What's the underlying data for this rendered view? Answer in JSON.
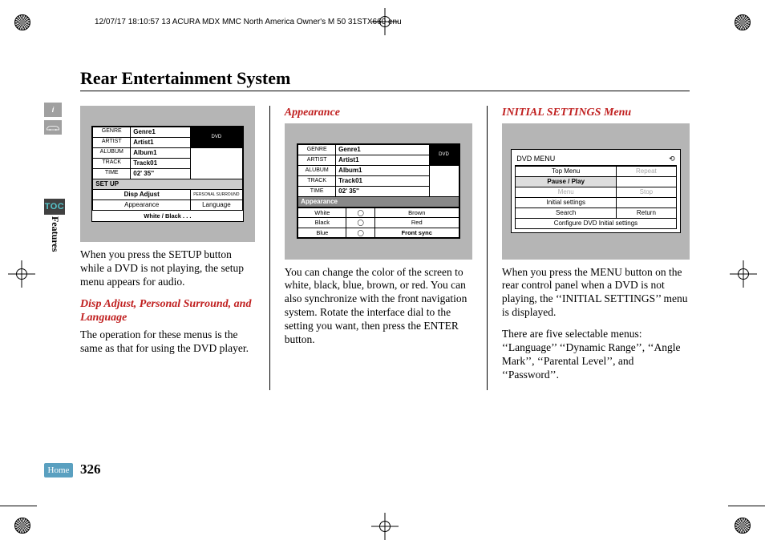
{
  "header": "12/07/17 18:10:57   13 ACURA MDX MMC North America Owner's M 50 31STX660 enu",
  "title": "Rear Entertainment System",
  "sidebar": {
    "toc": "TOC",
    "section": "Features",
    "home": "Home"
  },
  "page_number": "326",
  "col1": {
    "screen": {
      "rows": [
        {
          "label": "GENRE",
          "value": "Genre1"
        },
        {
          "label": "ARTIST",
          "value": "Artist1"
        },
        {
          "label": "ALUBUM",
          "value": "Album1"
        },
        {
          "label": "TRACK",
          "value": "Track01"
        },
        {
          "label": "TIME",
          "value": "02' 35''"
        }
      ],
      "badge": "DVD",
      "setup_label": "SET UP",
      "disp_adjust": "Disp Adjust",
      "personal": "PERSONAL SURROUND",
      "appearance": "Appearance",
      "language": "Language",
      "footer": "White / Black . . ."
    },
    "p1": "When you press the SETUP button while a DVD is not playing, the setup menu appears for audio.",
    "sub": "Disp Adjust, Personal Surround, and Language",
    "p2": "The operation for these menus is the same as that for using the DVD player."
  },
  "col2": {
    "heading": "Appearance",
    "screen": {
      "rows": [
        {
          "label": "GENRE",
          "value": "Genre1"
        },
        {
          "label": "ARTIST",
          "value": "Artist1"
        },
        {
          "label": "ALUBUM",
          "value": "Album1"
        },
        {
          "label": "TRACK",
          "value": "Track01"
        },
        {
          "label": "TIME",
          "value": "02' 35''"
        }
      ],
      "badge": "DVD",
      "appearance_label": "Appearance",
      "colors": {
        "white": "White",
        "brown": "Brown",
        "black": "Black",
        "red": "Red",
        "blue": "Blue",
        "front": "Front sync"
      }
    },
    "p1": "You can change the color of the screen to white, black, blue, brown, or red. You can also synchronize with the front navigation system. Rotate the interface dial to the setting you want, then press the ENTER button."
  },
  "col3": {
    "heading": "INITIAL SETTINGS Menu",
    "screen": {
      "title": "DVD  MENU",
      "items": {
        "top": "Top Menu",
        "pause": "Pause / Play",
        "repeat": "Repeat",
        "menu": "Menu",
        "stop": "Stop",
        "initial": "Initial settings",
        "search": "Search",
        "return": "Return",
        "configure": "Configure DVD Initial settings"
      }
    },
    "p1": "When you press the MENU button on the rear control panel when a DVD is not playing, the ‘‘INITIAL SETTINGS’’ menu is displayed.",
    "p2": "There are five selectable menus: ‘‘Language’’ ‘‘Dynamic Range’’, ‘‘Angle Mark’’, ‘‘Parental Level’’, and ‘‘Password’’."
  }
}
